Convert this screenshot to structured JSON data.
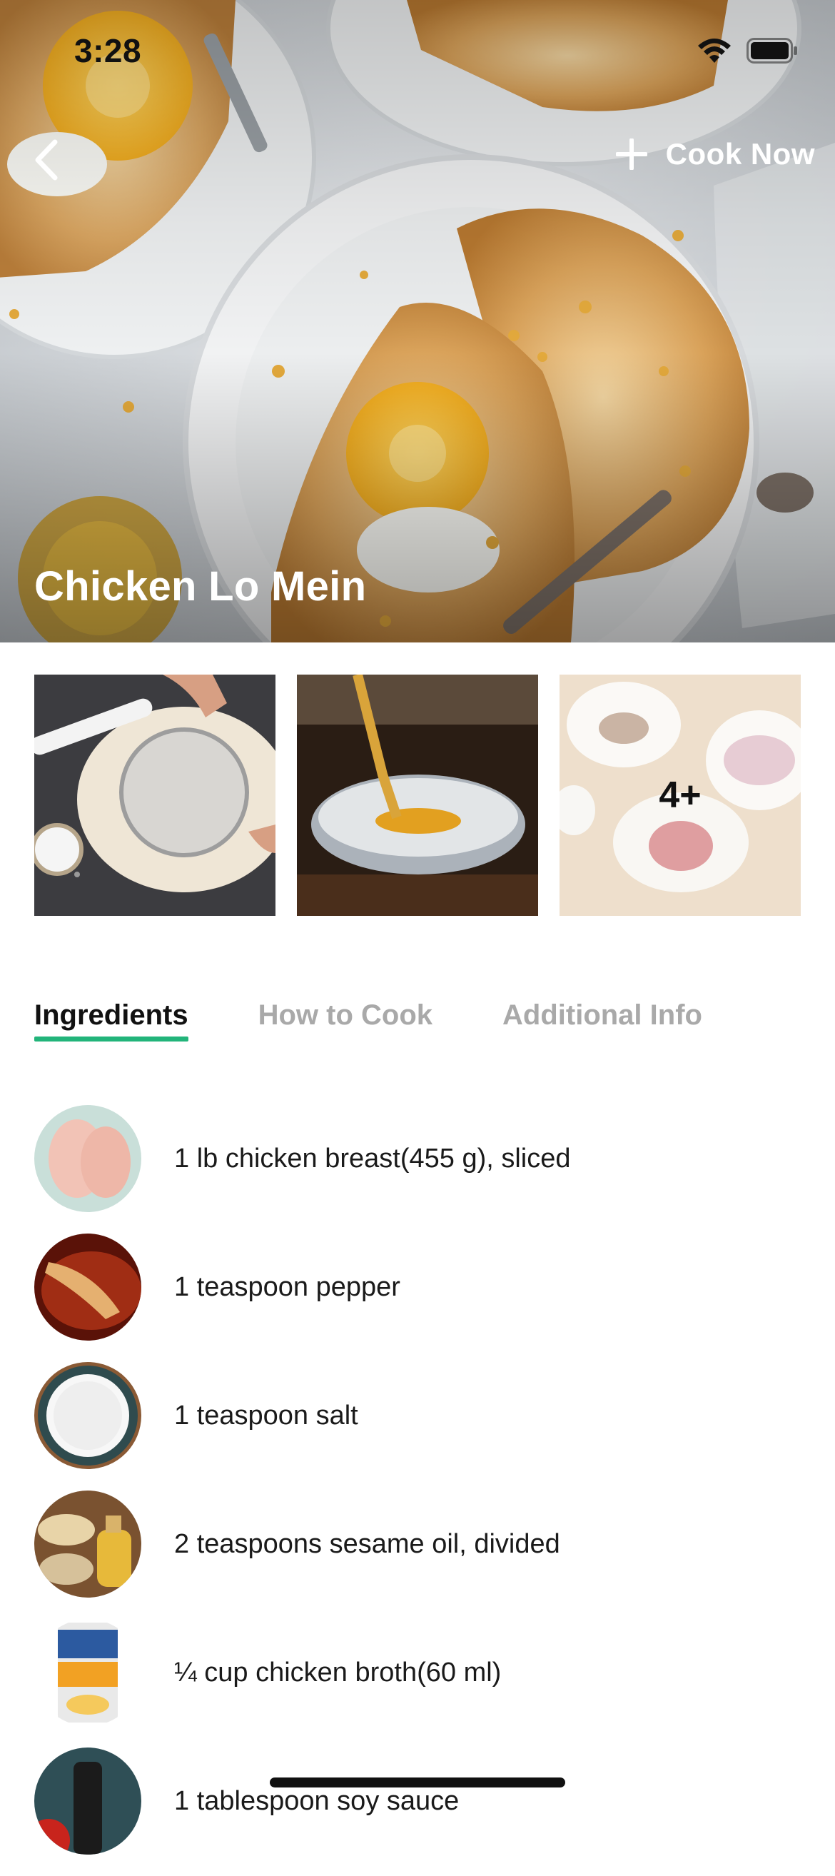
{
  "status_bar": {
    "time": "3:28",
    "icons": [
      "wifi-icon",
      "battery-icon"
    ]
  },
  "header": {
    "back_icon": "chevron-left-icon",
    "cook_now_icon": "plus-icon",
    "cook_now_label": "Cook Now"
  },
  "recipe": {
    "title": "Chicken Lo Mein"
  },
  "gallery": {
    "more_label": "4+"
  },
  "tabs": [
    {
      "label": "Ingredients",
      "active": true
    },
    {
      "label": "How to Cook",
      "active": false
    },
    {
      "label": "Additional Info",
      "active": false
    }
  ],
  "ingredients": [
    {
      "text": "1 lb chicken breast(455 g), sliced"
    },
    {
      "text": "1 teaspoon pepper"
    },
    {
      "text": "1 teaspoon salt"
    },
    {
      "text": "2 teaspoons sesame oil, divided"
    },
    {
      "text": "¼ cup chicken broth(60 ml)"
    },
    {
      "text": "1 tablespoon soy sauce"
    }
  ],
  "colors": {
    "accent": "#22b47a",
    "inactive_tab": "#a9a9a9",
    "text": "#1a1a1a"
  }
}
